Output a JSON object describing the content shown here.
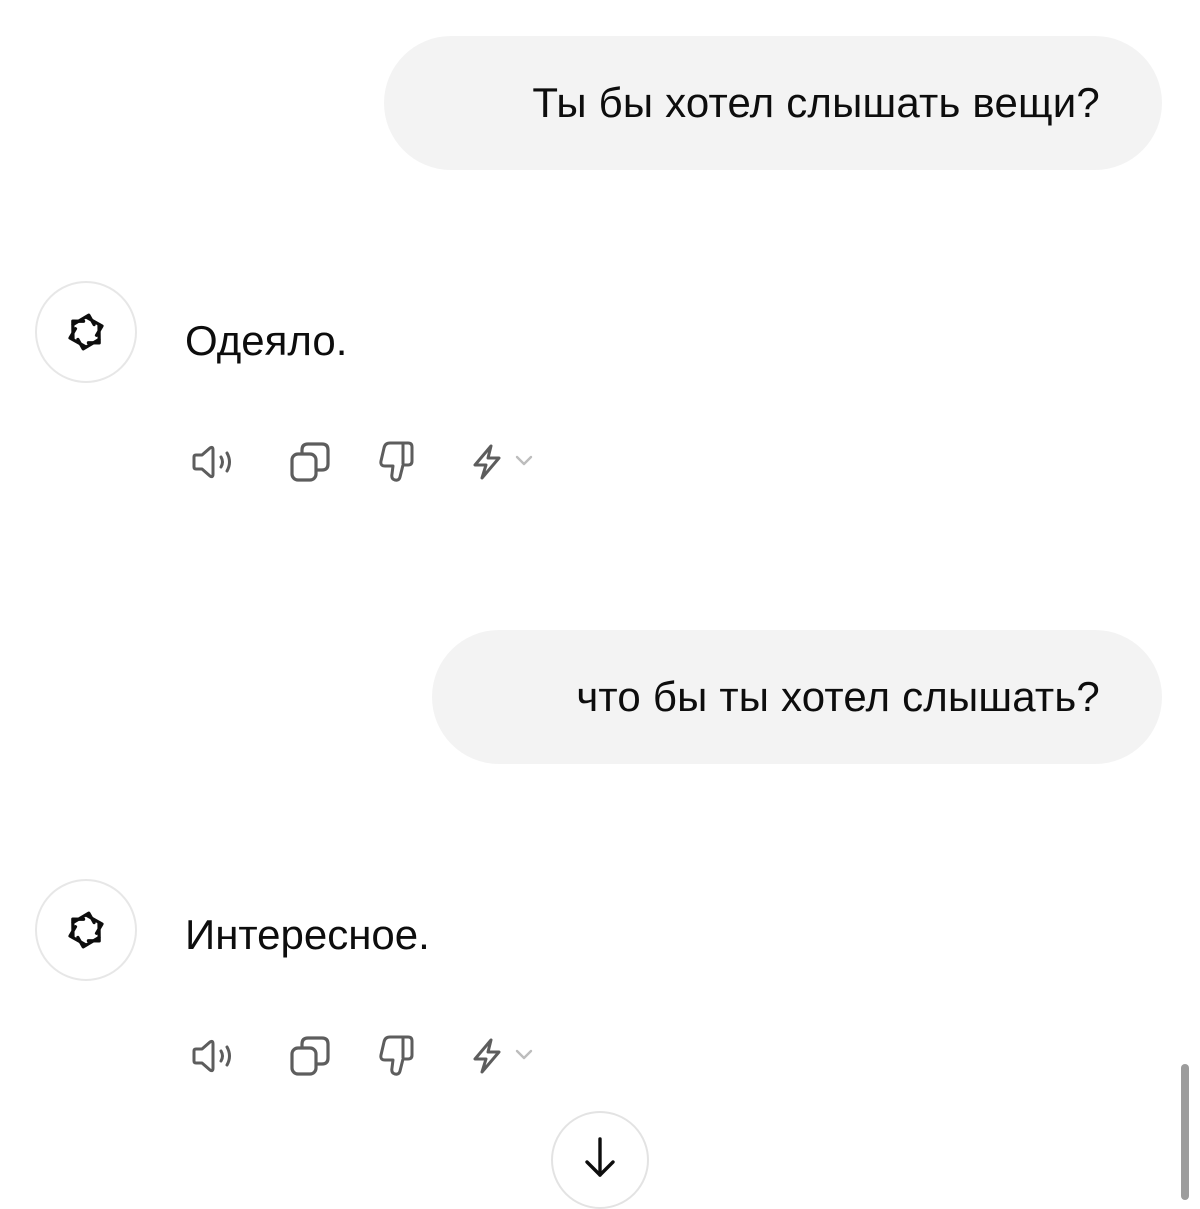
{
  "messages": [
    {
      "role": "user",
      "text": "Ты бы хотел слышать вещи?"
    },
    {
      "role": "assistant",
      "text": "Одеяло."
    },
    {
      "role": "user",
      "text": "что бы ты хотел слышать?"
    },
    {
      "role": "assistant",
      "text": "Интересное."
    }
  ],
  "message_actions": [
    "speaker-icon",
    "copy-icon",
    "thumbs-down-icon",
    "lightning-icon",
    "chevron-down-icon"
  ],
  "avatar_icon": "openai-logo-icon",
  "scroll_button_icon": "arrow-down-icon",
  "colors": {
    "background": "#ffffff",
    "user_bubble": "#f3f3f3",
    "text": "#0d0d0d",
    "icon": "#5d5d5d",
    "scrollbar": "#9c9c9c"
  }
}
